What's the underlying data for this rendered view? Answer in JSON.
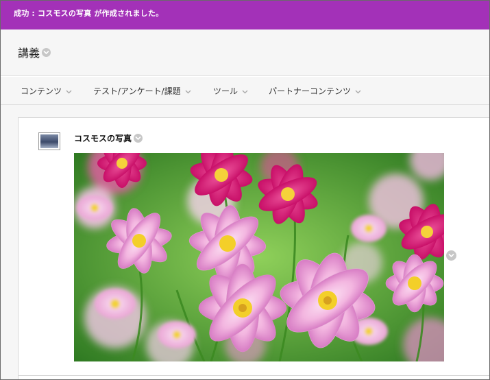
{
  "banner": {
    "message": "成功 : コスモスの写真 が作成されました。"
  },
  "header": {
    "course_title": "講義"
  },
  "menu": {
    "items": [
      {
        "label": "コンテンツ"
      },
      {
        "label": "テスト/アンケート/課題"
      },
      {
        "label": "ツール"
      },
      {
        "label": "パートナーコンテンツ"
      }
    ]
  },
  "content": {
    "item_title": "コスモスの写真",
    "item_icon": "image-thumbnail-icon",
    "photo_subject": "cosmos flowers"
  },
  "colors": {
    "banner_bg": "#a331b8",
    "page_bg": "#f6f6f6",
    "chevron_circle": "#c7c7c7"
  }
}
